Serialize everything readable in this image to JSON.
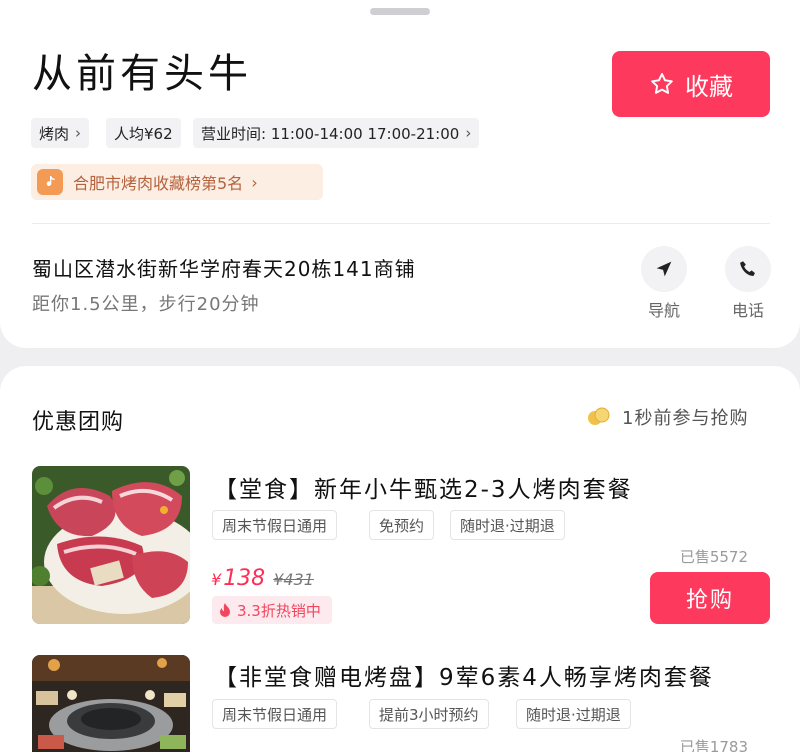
{
  "shop": {
    "name": "从前有头牛",
    "favorite_label": "收藏",
    "category": "烤肉",
    "avg_price": "人均¥62",
    "hours": "营业时间: 11:00-14:00 17:00-21:00",
    "rank": "合肥市烤肉收藏榜第5名",
    "address": "蜀山区潜水街新华学府春天20栋141商铺",
    "distance": "距你1.5公里，步行20分钟",
    "nav_label": "导航",
    "phone_label": "电话"
  },
  "deals_section": {
    "title": "优惠团购",
    "recent": "1秒前参与抢购"
  },
  "deals": [
    {
      "name": "【堂食】新年小牛甄选2-3人烤肉套餐",
      "tags": [
        "周末节假日通用",
        "免预约",
        "随时退·过期退"
      ],
      "sold": "已售5572",
      "currency": "¥",
      "price": "138",
      "original_price": "¥431",
      "discount": "3.3折热销中",
      "buy_label": "抢购"
    },
    {
      "name": "【非堂食赠电烤盘】9荤6素4人畅享烤肉套餐",
      "tags": [
        "周末节假日通用",
        "提前3小时预约",
        "随时退·过期退"
      ],
      "sold": "已售1783"
    }
  ],
  "icons": {
    "favorite": "star-outline-icon",
    "chevron": "chevron-right-icon",
    "rank_logo": "music-note-logo-icon",
    "navigate": "navigation-arrow-icon",
    "phone": "phone-icon",
    "coins": "coins-icon",
    "discount": "flame-icon"
  },
  "colors": {
    "accent": "#fd3a5d",
    "price": "#ff2d55",
    "rank_text": "#b5623d",
    "rank_bg": "#fdeee4"
  }
}
